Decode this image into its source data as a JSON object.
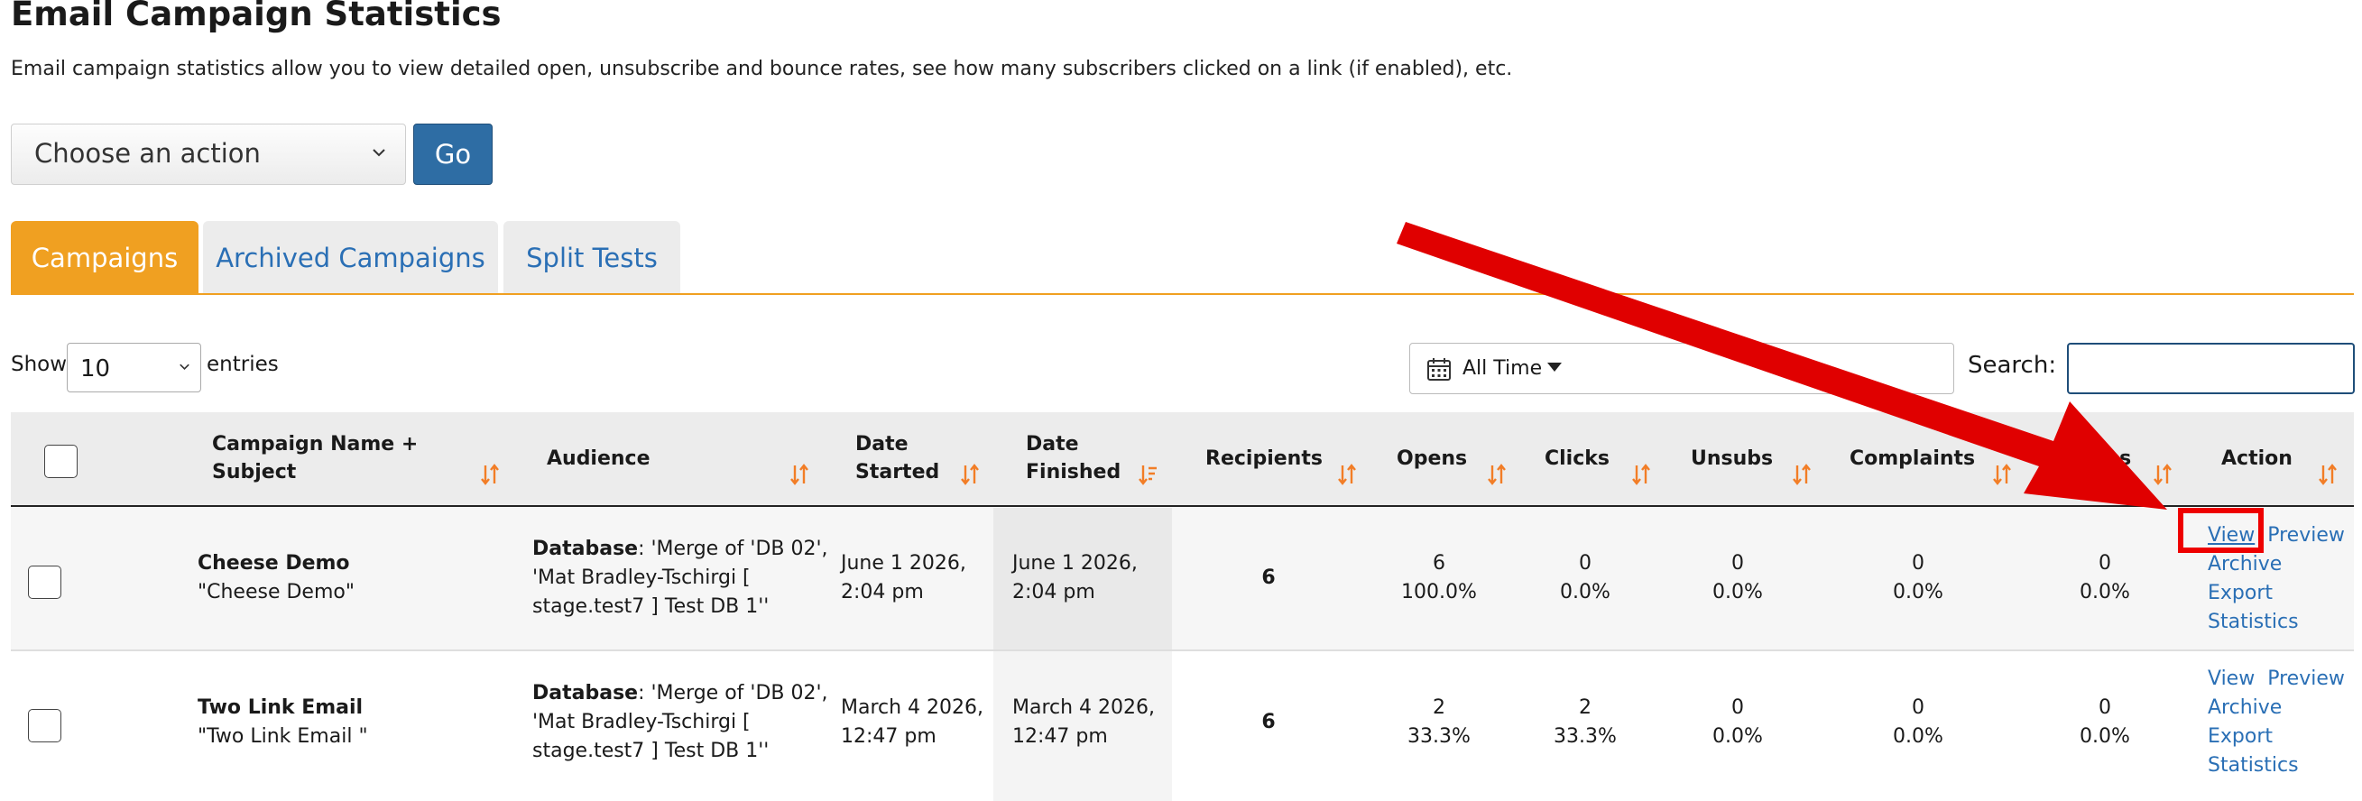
{
  "page": {
    "title": "Email Campaign Statistics",
    "description": "Email campaign statistics allow you to view detailed open, unsubscribe and bounce rates, see how many subscribers clicked on a link (if enabled), etc."
  },
  "actions": {
    "select_value": "Choose an action",
    "go_label": "Go"
  },
  "tabs": [
    {
      "label": "Campaigns",
      "active": true
    },
    {
      "label": "Archived Campaigns",
      "active": false
    },
    {
      "label": "Split Tests",
      "active": false
    }
  ],
  "controls": {
    "show_label": "Show",
    "entries_value": "10",
    "entries_label": "entries",
    "date_range": "All Time",
    "search_label": "Search:",
    "search_value": ""
  },
  "columns": {
    "name_l1": "Campaign Name +",
    "name_l2": "Subject",
    "audience": "Audience",
    "started_l1": "Date",
    "started_l2": "Started",
    "finished_l1": "Date",
    "finished_l2": "Finished",
    "recipients": "Recipients",
    "opens": "Opens",
    "clicks": "Clicks",
    "unsubs": "Unsubs",
    "complaints": "Complaints",
    "bounces": "Bounces",
    "action": "Action"
  },
  "rows": [
    {
      "name": "Cheese Demo",
      "subject": "\"Cheese Demo\"",
      "audience_label": "Database",
      "audience_l1": ": 'Merge of 'DB 02',",
      "audience_l2": "'Mat Bradley-Tschirgi [",
      "audience_l3": "stage.test7 ] Test DB 1''",
      "started_l1": "June 1 2026,",
      "started_l2": "2:04 pm",
      "finished_l1": "June 1 2026,",
      "finished_l2": "2:04 pm",
      "recipients": "6",
      "opens": "6",
      "opens_pct": "100.0%",
      "clicks": "0",
      "clicks_pct": "0.0%",
      "unsubs": "0",
      "unsubs_pct": "0.0%",
      "complaints": "0",
      "complaints_pct": "0.0%",
      "bounces": "0",
      "bounces_pct": "0.0%",
      "actions": {
        "view": "View",
        "preview": "Preview",
        "archive": "Archive",
        "export": "Export",
        "statistics": "Statistics"
      }
    },
    {
      "name": "Two Link Email",
      "subject": "\"Two Link Email \"",
      "audience_label": "Database",
      "audience_l1": ": 'Merge of 'DB 02',",
      "audience_l2": "'Mat Bradley-Tschirgi [",
      "audience_l3": "stage.test7 ] Test DB 1''",
      "started_l1": "March 4 2026,",
      "started_l2": "12:47 pm",
      "finished_l1": "March 4 2026,",
      "finished_l2": "12:47 pm",
      "recipients": "6",
      "opens": "2",
      "opens_pct": "33.3%",
      "clicks": "2",
      "clicks_pct": "33.3%",
      "unsubs": "0",
      "unsubs_pct": "0.0%",
      "complaints": "0",
      "complaints_pct": "0.0%",
      "bounces": "0",
      "bounces_pct": "0.0%",
      "actions": {
        "view": "View",
        "preview": "Preview",
        "archive": "Archive",
        "export": "Export",
        "statistics": "Statistics"
      }
    }
  ],
  "colors": {
    "accent_tab": "#f0a021",
    "primary_button": "#2e6da4",
    "link": "#2a6fb5",
    "sort_icon": "#f27d26",
    "annotation": "#e00000"
  },
  "icons": [
    "chevron-down-icon",
    "calendar-icon",
    "caret-down-icon",
    "sort-icon",
    "sort-desc-icon",
    "annotation-arrow",
    "annotation-highlight-box"
  ]
}
